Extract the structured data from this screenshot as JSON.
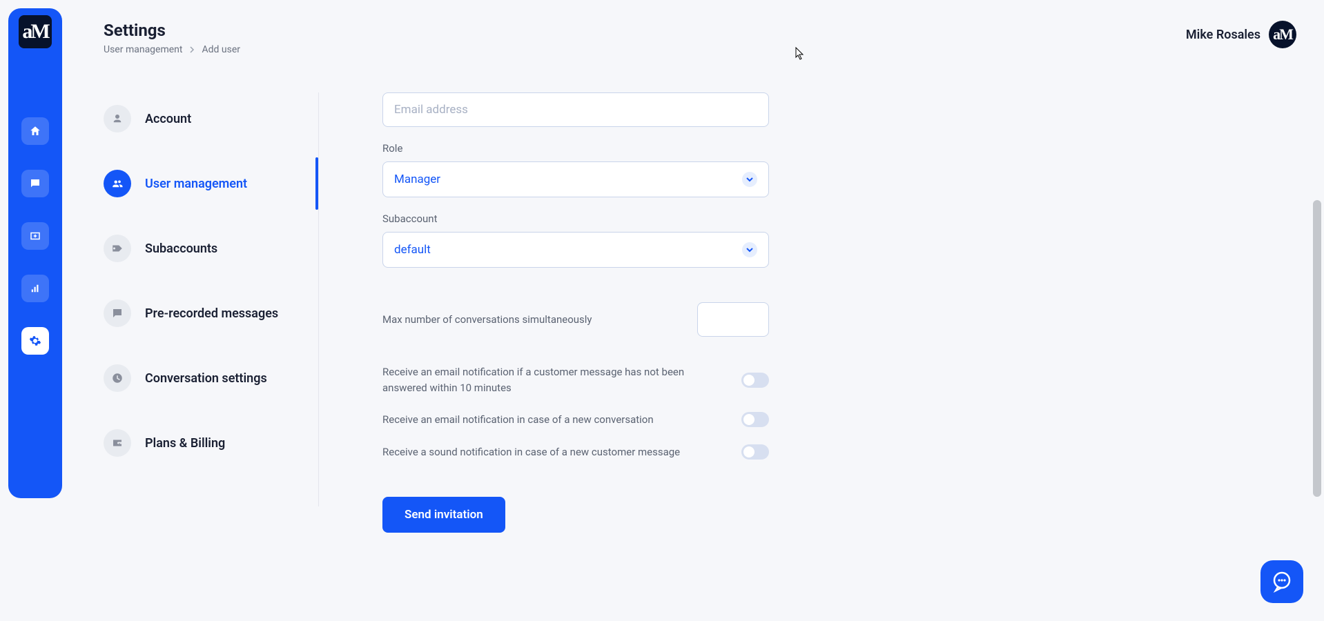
{
  "header": {
    "title": "Settings",
    "breadcrumb": [
      "User management",
      "Add user"
    ],
    "user_name": "Mike Rosales"
  },
  "sidebar_logo": "aM",
  "secondary_nav": [
    {
      "label": "Account",
      "icon": "person"
    },
    {
      "label": "User management",
      "icon": "people"
    },
    {
      "label": "Subaccounts",
      "icon": "tag"
    },
    {
      "label": "Pre-recorded messages",
      "icon": "message"
    },
    {
      "label": "Conversation settings",
      "icon": "clock"
    },
    {
      "label": "Plans & Billing",
      "icon": "wallet"
    }
  ],
  "form": {
    "email_placeholder": "Email address",
    "role_label": "Role",
    "role_value": "Manager",
    "subaccount_label": "Subaccount",
    "subaccount_value": "default",
    "max_conv_label": "Max number of conversations simultaneously",
    "max_conv_value": "",
    "toggles": [
      {
        "label": "Receive an email notification if a customer message has not been answered within 10 minutes",
        "on": false
      },
      {
        "label": "Receive an email notification in case of a new conversation",
        "on": false
      },
      {
        "label": "Receive a sound notification in case of a new customer message",
        "on": false
      }
    ],
    "submit_label": "Send invitation"
  }
}
